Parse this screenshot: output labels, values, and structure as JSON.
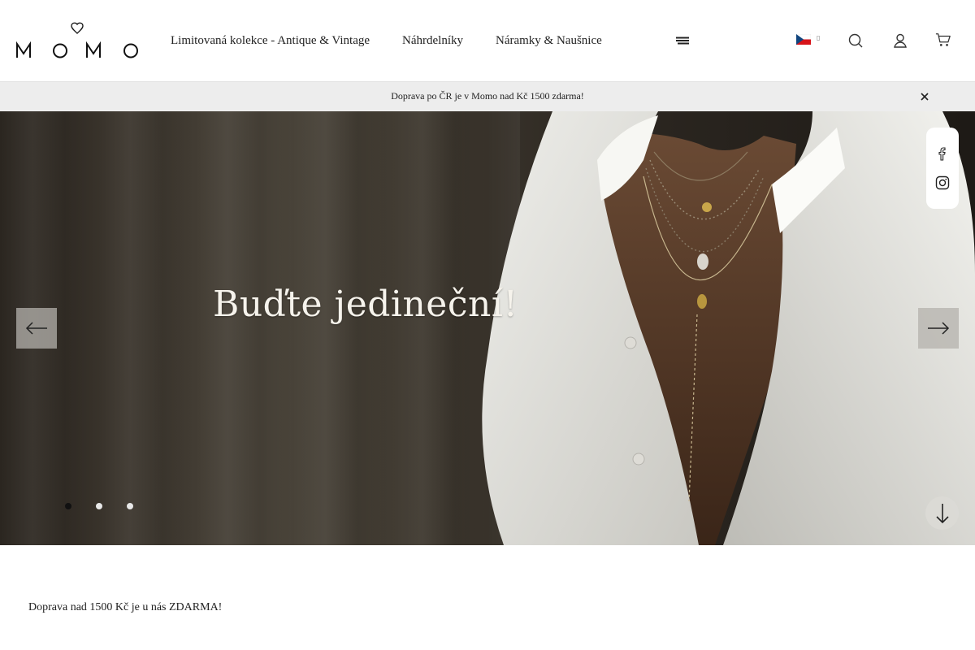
{
  "brand": {
    "logo_text": "MOMO"
  },
  "nav": {
    "items": [
      {
        "label": "Limitovaná kolekce - Antique & Vintage"
      },
      {
        "label": "Náhrdelníky"
      },
      {
        "label": "Náramky & Naušnice"
      }
    ]
  },
  "header_icons": {
    "menu": "menu-icon",
    "language": "czech-flag-icon",
    "search": "search-icon",
    "account": "user-icon",
    "cart": "cart-icon"
  },
  "announcement": {
    "text": "Doprava po ČR je v Momo nad Kč 1500 zdarma!"
  },
  "hero": {
    "title": "Buďte jedineční!",
    "slides_total": 3,
    "active_slide": 1
  },
  "social": [
    "facebook-icon",
    "instagram-icon"
  ],
  "shipping_note": "Doprava nad 1500 Kč je u nás ZDARMA!",
  "colors": {
    "text": "#222222",
    "announce_bg": "#ededed",
    "dot_active": "#111111",
    "dot_inactive": "#e8e8e8"
  }
}
